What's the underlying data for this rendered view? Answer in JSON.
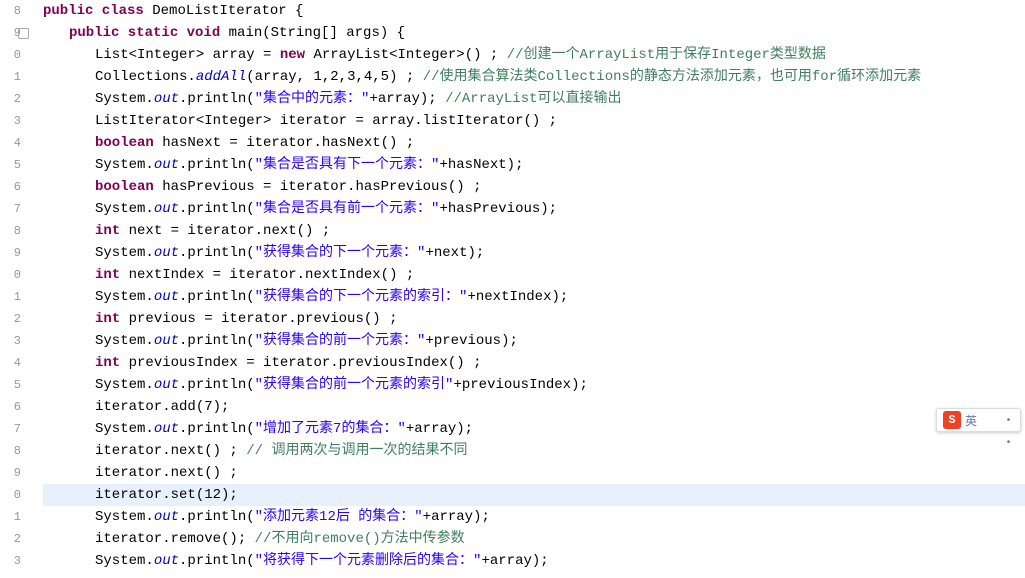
{
  "gutter": [
    "8",
    "9",
    "0",
    "1",
    "2",
    "3",
    "4",
    "5",
    "6",
    "7",
    "8",
    "9",
    "0",
    "1",
    "2",
    "3",
    "4",
    "5",
    "6",
    "7",
    "8",
    "9",
    "0",
    "1",
    "2",
    "3"
  ],
  "lines": {
    "l0": {
      "kw1": "public class",
      "cls": "DemoListIterator",
      "brace": " {"
    },
    "l1": {
      "kw1": "public static void",
      "m": " main(String[] args) {"
    },
    "l2": {
      "a": "List<Integer> array = ",
      "kw": "new",
      "b": " ArrayList<Integer>() ;  ",
      "c": "//创建一个ArrayList用于保存Integer类型数据"
    },
    "l3": {
      "a": "Collections.",
      "f": "addAll",
      "b": "(array, 1,2,3,4,5) ;                    ",
      "c": "//使用集合算法类Collections的静态方法添加元素，也可用for循环添加元素"
    },
    "l4": {
      "a": "System.",
      "f": "out",
      "b": ".println(",
      "s": "\"集合中的元素：\"",
      "d": "+array);         ",
      "c": "//ArrayList可以直接输出"
    },
    "l5": {
      "a": "ListIterator<Integer> iterator =  array.listIterator() ;"
    },
    "l6": {
      "kw": "boolean",
      "a": " hasNext = iterator.hasNext() ;"
    },
    "l7": {
      "a": "System.",
      "f": "out",
      "b": ".println(",
      "s": "\"集合是否具有下一个元素：\"",
      "d": "+hasNext);"
    },
    "l8": {
      "kw": "boolean",
      "a": " hasPrevious = iterator.hasPrevious() ;"
    },
    "l9": {
      "a": "System.",
      "f": "out",
      "b": ".println(",
      "s": "\"集合是否具有前一个元素：\"",
      "d": "+hasPrevious);"
    },
    "l10": {
      "kw": "int",
      "a": " next = iterator.next() ;"
    },
    "l11": {
      "a": "System.",
      "f": "out",
      "b": ".println(",
      "s": "\"获得集合的下一个元素：\"",
      "d": "+next);"
    },
    "l12": {
      "kw": "int",
      "a": "  nextIndex  = iterator.nextIndex() ;"
    },
    "l13": {
      "a": "System.",
      "f": "out",
      "b": ".println(",
      "s": "\"获得集合的下一个元素的索引：\"",
      "d": "+nextIndex);"
    },
    "l14": {
      "kw": "int",
      "a": " previous = iterator.previous() ;"
    },
    "l15": {
      "a": "System.",
      "f": "out",
      "b": ".println(",
      "s": "\"获得集合的前一个元素：\"",
      "d": "+previous);"
    },
    "l16": {
      "kw": "int",
      "a": " previousIndex = iterator.previousIndex() ;"
    },
    "l17": {
      "a": "System.",
      "f": "out",
      "b": ".println(",
      "s": "\"获得集合的前一个元素的索引\"",
      "d": "+previousIndex);"
    },
    "l18": {
      "a": "iterator.add(7);"
    },
    "l19": {
      "a": "System.",
      "f": "out",
      "b": ".println(",
      "s": "\"增加了元素7的集合：\"",
      "d": "+array);"
    },
    "l20": {
      "a": "iterator.next() ;  ",
      "c": "//   调用两次与调用一次的结果不同"
    },
    "l21": {
      "a": "iterator.next() ;"
    },
    "l22": {
      "a": "iterator.set(12);"
    },
    "l23": {
      "a": "System.",
      "f": "out",
      "b": ".println(",
      "s": "\"添加元素12后 的集合：\"",
      "d": "+array);"
    },
    "l24": {
      "a": "iterator.remove();                                         ",
      "c": "//不用向remove()方法中传参数"
    },
    "l25": {
      "a": "System.",
      "f": "out",
      "b": ".println(",
      "s": "\"将获得下一个元素删除后的集合：\"",
      "d": "+array);"
    }
  },
  "ime": {
    "logo": "S",
    "lang": "英"
  }
}
